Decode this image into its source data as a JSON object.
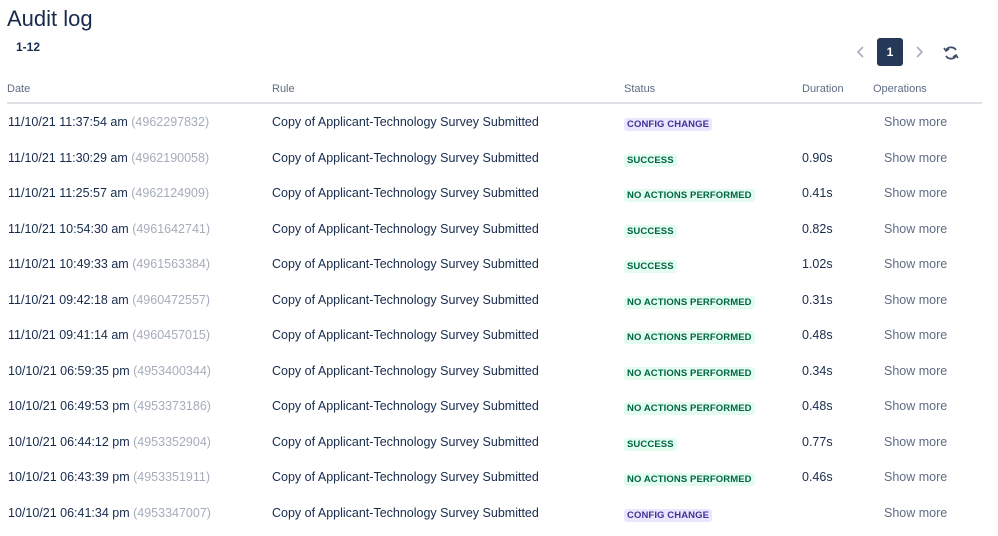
{
  "header": {
    "title": "Audit log",
    "range": "1-12"
  },
  "pagination": {
    "current_page": "1",
    "prev_icon": "chevron-left-icon",
    "next_icon": "chevron-right-icon",
    "refresh_icon": "refresh-icon"
  },
  "table": {
    "columns": [
      "Date",
      "Rule",
      "Status",
      "Duration",
      "Operations"
    ],
    "rows": [
      {
        "date": "11/10/21 11:37:54 am",
        "id": "(4962297832)",
        "rule": "Copy of Applicant-Technology Survey Submitted",
        "status": "CONFIG CHANGE",
        "status_type": "config",
        "duration": "",
        "action": "Show more"
      },
      {
        "date": "11/10/21 11:30:29 am",
        "id": "(4962190058)",
        "rule": "Copy of Applicant-Technology Survey Submitted",
        "status": "SUCCESS",
        "status_type": "success",
        "duration": "0.90s",
        "action": "Show more"
      },
      {
        "date": "11/10/21 11:25:57 am",
        "id": "(4962124909)",
        "rule": "Copy of Applicant-Technology Survey Submitted",
        "status": "NO ACTIONS PERFORMED",
        "status_type": "success",
        "duration": "0.41s",
        "action": "Show more"
      },
      {
        "date": "11/10/21 10:54:30 am",
        "id": "(4961642741)",
        "rule": "Copy of Applicant-Technology Survey Submitted",
        "status": "SUCCESS",
        "status_type": "success",
        "duration": "0.82s",
        "action": "Show more"
      },
      {
        "date": "11/10/21 10:49:33 am",
        "id": "(4961563384)",
        "rule": "Copy of Applicant-Technology Survey Submitted",
        "status": "SUCCESS",
        "status_type": "success",
        "duration": "1.02s",
        "action": "Show more"
      },
      {
        "date": "11/10/21 09:42:18 am",
        "id": "(4960472557)",
        "rule": "Copy of Applicant-Technology Survey Submitted",
        "status": "NO ACTIONS PERFORMED",
        "status_type": "success",
        "duration": "0.31s",
        "action": "Show more"
      },
      {
        "date": "11/10/21 09:41:14 am",
        "id": "(4960457015)",
        "rule": "Copy of Applicant-Technology Survey Submitted",
        "status": "NO ACTIONS PERFORMED",
        "status_type": "success",
        "duration": "0.48s",
        "action": "Show more"
      },
      {
        "date": "10/10/21 06:59:35 pm",
        "id": "(4953400344)",
        "rule": "Copy of Applicant-Technology Survey Submitted",
        "status": "NO ACTIONS PERFORMED",
        "status_type": "success",
        "duration": "0.34s",
        "action": "Show more"
      },
      {
        "date": "10/10/21 06:49:53 pm",
        "id": "(4953373186)",
        "rule": "Copy of Applicant-Technology Survey Submitted",
        "status": "NO ACTIONS PERFORMED",
        "status_type": "success",
        "duration": "0.48s",
        "action": "Show more"
      },
      {
        "date": "10/10/21 06:44:12 pm",
        "id": "(4953352904)",
        "rule": "Copy of Applicant-Technology Survey Submitted",
        "status": "SUCCESS",
        "status_type": "success",
        "duration": "0.77s",
        "action": "Show more"
      },
      {
        "date": "10/10/21 06:43:39 pm",
        "id": "(4953351911)",
        "rule": "Copy of Applicant-Technology Survey Submitted",
        "status": "NO ACTIONS PERFORMED",
        "status_type": "success",
        "duration": "0.46s",
        "action": "Show more"
      },
      {
        "date": "10/10/21 06:41:34 pm",
        "id": "(4953347007)",
        "rule": "Copy of Applicant-Technology Survey Submitted",
        "status": "CONFIG CHANGE",
        "status_type": "config",
        "duration": "",
        "action": "Show more"
      }
    ]
  },
  "colors": {
    "config_bg": "#eae6ff",
    "config_fg": "#403294",
    "success_bg": "#e3fcef",
    "success_fg": "#006644",
    "pager_active": "#253858"
  }
}
